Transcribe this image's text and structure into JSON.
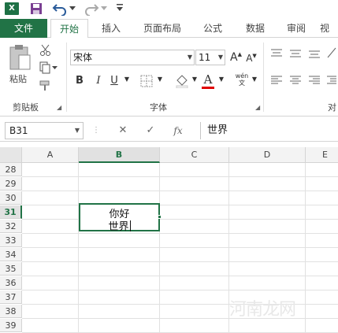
{
  "qat": {
    "logo": "X"
  },
  "tabs": [
    "文件",
    "开始",
    "插入",
    "页面布局",
    "公式",
    "数据",
    "审阅",
    "视"
  ],
  "clipboard": {
    "paste_label": "粘贴",
    "group_label": "剪贴板"
  },
  "font": {
    "name": "宋体",
    "size": "11",
    "group_label": "字体",
    "bold": "B",
    "italic": "I",
    "underline": "U",
    "phonetic": "wén"
  },
  "alignment": {
    "group_label": "对"
  },
  "formula_bar": {
    "name_box": "B31",
    "cancel": "✕",
    "enter": "✓",
    "fx": "fx",
    "value": "世界"
  },
  "grid": {
    "columns": [
      "A",
      "B",
      "C",
      "D",
      "E"
    ],
    "selected_column": "B",
    "rows": [
      "28",
      "29",
      "30",
      "31",
      "32",
      "33",
      "34",
      "35",
      "36",
      "37",
      "38",
      "39"
    ],
    "selected_row": "31",
    "active_cell": "B31",
    "cell_lines": [
      "你好",
      "世界"
    ]
  },
  "watermark": "河南龙网",
  "colors": {
    "accent": "#217346"
  }
}
